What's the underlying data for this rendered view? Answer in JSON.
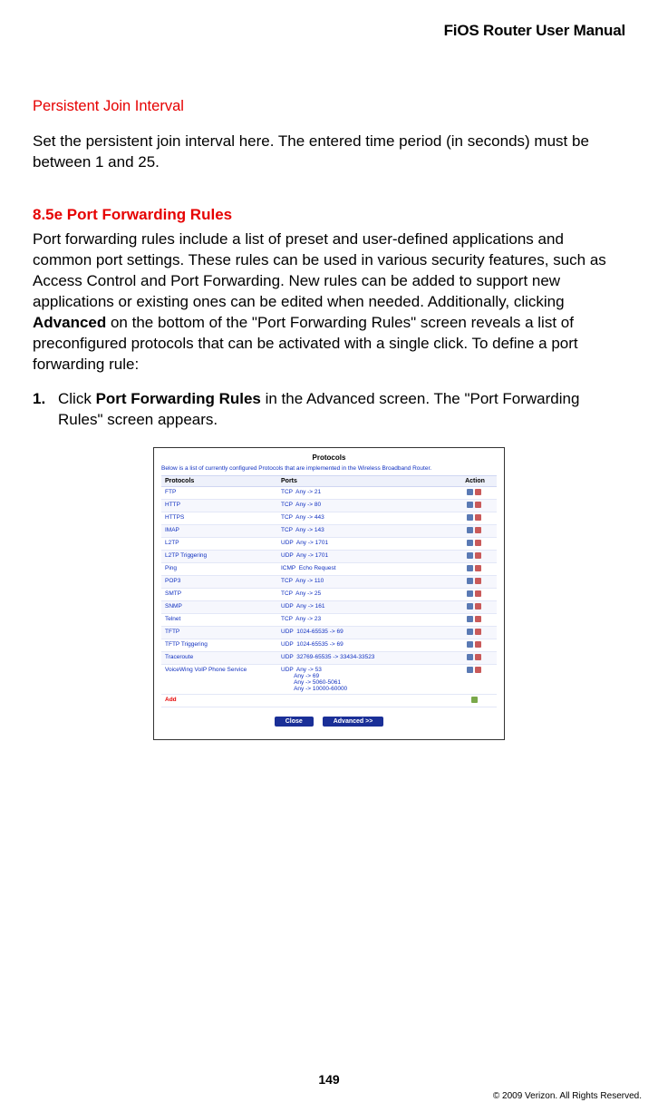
{
  "header": {
    "title": "FiOS Router User Manual"
  },
  "section1": {
    "heading": "Persistent Join Interval",
    "body": "Set the persistent join interval here. The entered time period (in seconds) must be between 1 and 25."
  },
  "section2": {
    "heading": "8.5e  Port Forwarding Rules",
    "body_pre": "Port forwarding rules include a list of preset and user-defined applications and common port settings. These rules can be used in various security features, such as Access Control and Port Forwarding. New rules can be added to support new applications or existing ones can be edited when needed.  Additionally, clicking ",
    "body_bold": "Advanced",
    "body_post": " on the bottom of the \"Port Forwarding Rules\" screen reveals a list of preconfigured protocols that can be activated with a single click. To define a port forwarding rule:"
  },
  "step1": {
    "num": "1.",
    "pre": "Click ",
    "bold": "Port Forwarding Rules",
    "post": " in the Advanced screen. The \"Port Forwarding Rules\" screen appears."
  },
  "screenshot": {
    "title": "Protocols",
    "subtitle": "Below is a list of currently configured Protocols that are implemented in the Wireless Broadband Router.",
    "cols": {
      "c1": "Protocols",
      "c2": "Ports",
      "c3": "Action"
    },
    "rows": [
      {
        "p": "FTP",
        "ports": "TCP  Any -> 21"
      },
      {
        "p": "HTTP",
        "ports": "TCP  Any -> 80"
      },
      {
        "p": "HTTPS",
        "ports": "TCP  Any -> 443"
      },
      {
        "p": "IMAP",
        "ports": "TCP  Any -> 143"
      },
      {
        "p": "L2TP",
        "ports": "UDP  Any -> 1701"
      },
      {
        "p": "L2TP Triggering",
        "ports": "UDP  Any -> 1701"
      },
      {
        "p": "Ping",
        "ports": "ICMP  Echo Request"
      },
      {
        "p": "POP3",
        "ports": "TCP  Any -> 110"
      },
      {
        "p": "SMTP",
        "ports": "TCP  Any -> 25"
      },
      {
        "p": "SNMP",
        "ports": "UDP  Any -> 161"
      },
      {
        "p": "Telnet",
        "ports": "TCP  Any -> 23"
      },
      {
        "p": "TFTP",
        "ports": "UDP  1024-65535 -> 69"
      },
      {
        "p": "TFTP Triggering",
        "ports": "UDP  1024-65535 -> 69"
      },
      {
        "p": "Traceroute",
        "ports": "UDP  32769-65535 -> 33434-33523"
      },
      {
        "p": "VoiceWing VoIP Phone Service",
        "ports": "UDP  Any -> 53\n        Any -> 69\n        Any -> 5060-5061\n        Any -> 10000-60000"
      }
    ],
    "add": "Add",
    "btn_close": "Close",
    "btn_adv": "Advanced >>"
  },
  "footer": {
    "page": "149",
    "copyright": "© 2009 Verizon. All Rights Reserved."
  }
}
